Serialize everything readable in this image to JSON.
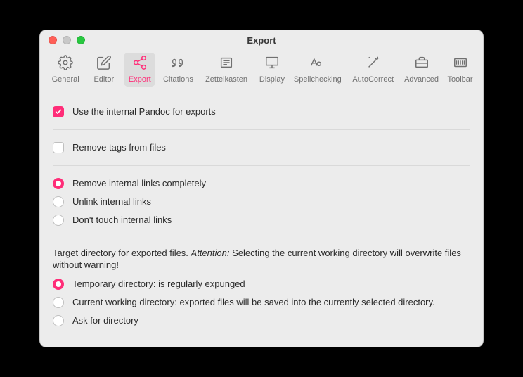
{
  "window": {
    "title": "Export"
  },
  "tabs": [
    {
      "label": "General"
    },
    {
      "label": "Editor"
    },
    {
      "label": "Export"
    },
    {
      "label": "Citations"
    },
    {
      "label": "Zettelkasten"
    },
    {
      "label": "Display"
    },
    {
      "label": "Spellchecking"
    },
    {
      "label": "AutoCorrect"
    },
    {
      "label": "Advanced"
    },
    {
      "label": "Toolbar"
    }
  ],
  "opts": {
    "pandoc": "Use the internal Pandoc for exports",
    "removeTags": "Remove tags from files",
    "link1": "Remove internal links completely",
    "link2": "Unlink internal links",
    "link3": "Don't touch internal links",
    "targetHelpA": "Target directory for exported files. ",
    "targetHelpEm": "Attention:",
    "targetHelpB": " Selecting the current working directory will overwrite files without warning!",
    "dir1": "Temporary directory: is regularly expunged",
    "dir2": "Current working directory: exported files will be saved into the currently selected directory.",
    "dir3": "Ask for directory"
  },
  "colors": {
    "accent": "#ff2d78"
  }
}
